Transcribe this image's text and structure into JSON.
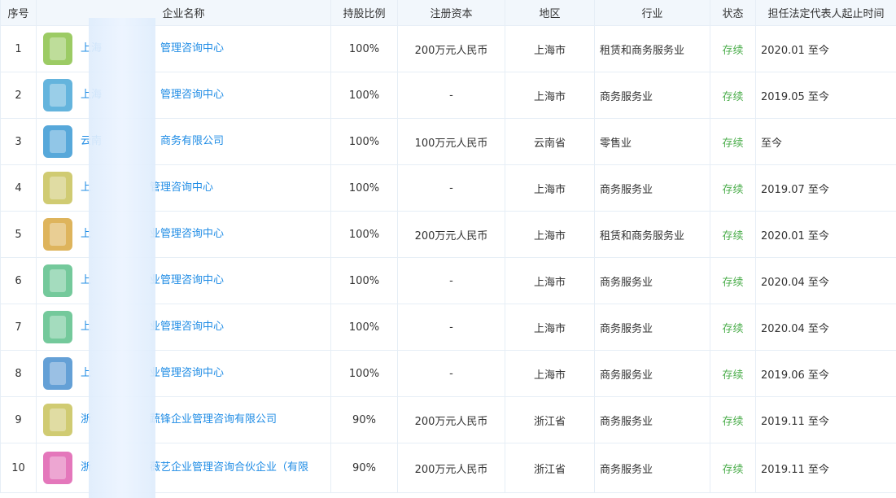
{
  "headers": [
    "序号",
    "企业名称",
    "持股比例",
    "注册资本",
    "地区",
    "行业",
    "状态",
    "担任法定代表人起止时间"
  ],
  "rows": [
    {
      "index": "1",
      "name": "上海",
      "name_tail": "管理咨询中心",
      "ratio": "100%",
      "capital": "200万元人民币",
      "region": "上海市",
      "industry": "租赁和商务服务业",
      "status": "存续",
      "period": "2020.01 至今",
      "logo_color": "#8bc34a"
    },
    {
      "index": "2",
      "name": "上海",
      "name_tail": "管理咨询中心",
      "ratio": "100%",
      "capital": "-",
      "region": "上海市",
      "industry": "商务服务业",
      "status": "存续",
      "period": "2019.05 至今",
      "logo_color": "#4aa8d8"
    },
    {
      "index": "3",
      "name": "云南",
      "name_tail": "商务有限公司",
      "ratio": "100%",
      "capital": "100万元人民币",
      "region": "云南省",
      "industry": "零售业",
      "status": "存续",
      "period": "至今",
      "logo_color": "#3a9ad4"
    },
    {
      "index": "4",
      "name": "上",
      "name_tail": "管理咨询中心",
      "ratio": "100%",
      "capital": "-",
      "region": "上海市",
      "industry": "商务服务业",
      "status": "存续",
      "period": "2019.07 至今",
      "logo_color": "#c8c25a"
    },
    {
      "index": "5",
      "name": "上",
      "name_tail": "业管理咨询中心",
      "ratio": "100%",
      "capital": "200万元人民币",
      "region": "上海市",
      "industry": "租赁和商务服务业",
      "status": "存续",
      "period": "2020.01 至今",
      "logo_color": "#d9a840"
    },
    {
      "index": "6",
      "name": "上",
      "name_tail": "业管理咨询中心",
      "ratio": "100%",
      "capital": "-",
      "region": "上海市",
      "industry": "商务服务业",
      "status": "存续",
      "period": "2020.04 至今",
      "logo_color": "#5cc08a"
    },
    {
      "index": "7",
      "name": "上",
      "name_tail": "业管理咨询中心",
      "ratio": "100%",
      "capital": "-",
      "region": "上海市",
      "industry": "商务服务业",
      "status": "存续",
      "period": "2020.04 至今",
      "logo_color": "#5cc08a"
    },
    {
      "index": "8",
      "name": "上",
      "name_tail": "业管理咨询中心",
      "ratio": "100%",
      "capital": "-",
      "region": "上海市",
      "industry": "商务服务业",
      "status": "存续",
      "period": "2019.06 至今",
      "logo_color": "#4a90d0"
    },
    {
      "index": "9",
      "name": "浙",
      "name_tail": "蔬锋企业管理咨询有限公司",
      "ratio": "90%",
      "capital": "200万元人民币",
      "region": "浙江省",
      "industry": "商务服务业",
      "status": "存续",
      "period": "2019.11 至今",
      "logo_color": "#c8c25a"
    },
    {
      "index": "10",
      "name": "浙",
      "name_tail": "薇艺企业管理咨询合伙企业（有限",
      "ratio": "90%",
      "capital": "200万元人民币",
      "region": "浙江省",
      "industry": "商务服务业",
      "status": "存续",
      "period": "2019.11 至今",
      "logo_color": "#e060b0"
    }
  ]
}
